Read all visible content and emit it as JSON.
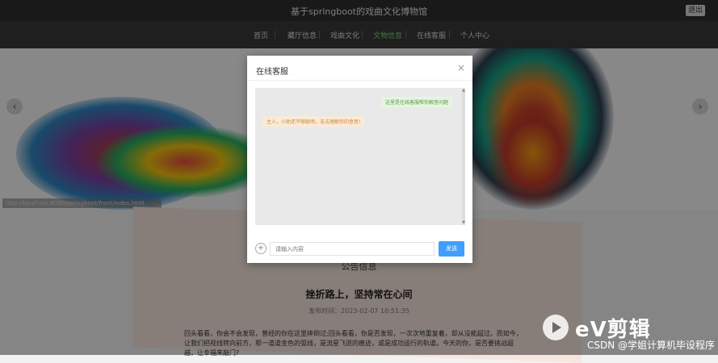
{
  "header": {
    "site_title": "基于springboot的戏曲文化博物馆",
    "logout_label": "退出"
  },
  "nav": {
    "items": [
      {
        "label": "首页",
        "active": false
      },
      {
        "label": "藏厅信息",
        "active": false
      },
      {
        "label": "戏曲文化",
        "active": false
      },
      {
        "label": "文物信息",
        "active": true
      },
      {
        "label": "在线客服",
        "active": false
      },
      {
        "label": "个人中心",
        "active": false
      }
    ]
  },
  "banner": {
    "prev_icon": "chevron-left-icon",
    "next_icon": "chevron-right-icon",
    "caption": "http://localhost:8080/springboot/front/index.html"
  },
  "chat_dialog": {
    "title": "在线客服",
    "close_icon": "close-icon",
    "messages": [
      {
        "side": "right",
        "text": "这里是在线客服帮你解答问题"
      },
      {
        "side": "left",
        "text": "主人，小助还不够聪明，无法理解你的意思!"
      }
    ],
    "input_placeholder": "请输入内容",
    "send_label": "发送",
    "upload_icon": "add-circle-icon"
  },
  "notice": {
    "heading": "公告信息",
    "title": "挫折路上，坚持常在心间",
    "date": "发布时间：2023-02-07 10:51:35",
    "body": "回头看看，你会不会发现，曾经的你在这里摔倒过;回头看看，你是否发现，一次次地重复着，却从没能超过。而如今，让我们把视线转向前方，那一道道金色的弧线，是流星飞逝的痕迹，或是成功运行的轨道。今天的你，是否要挑战超越，让幸福来敲门?"
  },
  "watermark": {
    "ev_label": "eV剪辑",
    "csdn_text": "CSDN @学姐计算机毕设程序"
  },
  "colors": {
    "nav_active": "#7fd37f",
    "send_button": "#409eff",
    "overlay": "rgba(0,0,0,0.45)"
  }
}
